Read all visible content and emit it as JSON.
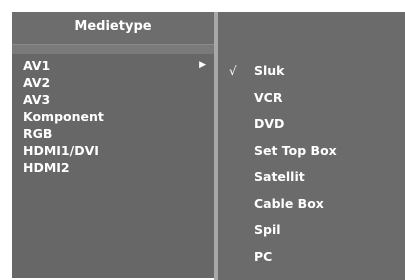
{
  "left_menu": {
    "title": "Medietype",
    "items": [
      {
        "label": "AV1",
        "arrow": "▶"
      },
      {
        "label": "AV2"
      },
      {
        "label": "AV3"
      },
      {
        "label": "Komponent"
      },
      {
        "label": "RGB"
      },
      {
        "label": "HDMI1/DVI"
      },
      {
        "label": "HDMI2"
      }
    ]
  },
  "right_menu": {
    "check_glyph": "√",
    "items": [
      {
        "label": "Sluk",
        "checked": true
      },
      {
        "label": "VCR"
      },
      {
        "label": "DVD"
      },
      {
        "label": "Set Top Box"
      },
      {
        "label": "Satellit"
      },
      {
        "label": "Cable Box"
      },
      {
        "label": "Spil"
      },
      {
        "label": "PC"
      }
    ]
  },
  "colors": {
    "panel_bg": "#676767",
    "header_bg": "#6d6d6d",
    "divider": "#a8a8a8",
    "text": "#ffffff"
  }
}
